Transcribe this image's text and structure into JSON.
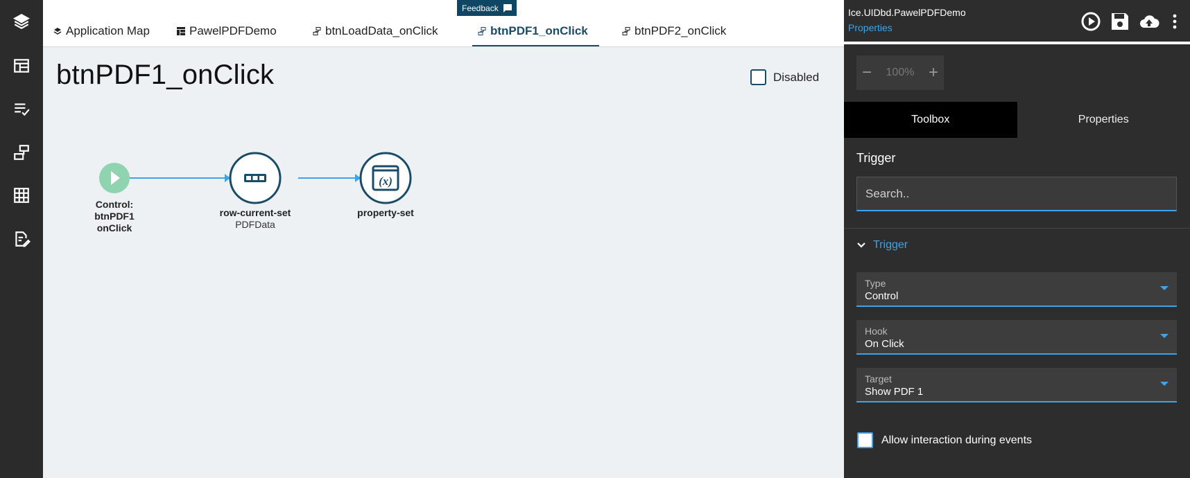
{
  "rail": {
    "items": [
      "layers-icon",
      "layout-icon",
      "checklist-icon",
      "flow-icon",
      "table-icon",
      "edit-doc-icon"
    ]
  },
  "feedback": {
    "label": "Feedback"
  },
  "tabs": [
    {
      "label": "Application Map",
      "icon": "layers-icon"
    },
    {
      "label": "PawelPDFDemo",
      "icon": "layout-icon"
    },
    {
      "label": "btnLoadData_onClick",
      "icon": "flow-icon"
    },
    {
      "label": "btnPDF1_onClick",
      "icon": "flow-icon",
      "active": true
    },
    {
      "label": "btnPDF2_onClick",
      "icon": "flow-icon"
    }
  ],
  "canvas": {
    "title": "btnPDF1_onClick",
    "disabled_label": "Disabled",
    "nodes": [
      {
        "line1": "Control:",
        "line2": "btnPDF1",
        "line3": "onClick",
        "kind": "trigger"
      },
      {
        "line1": "row-current-set",
        "sub": "PDFData",
        "kind": "action"
      },
      {
        "line1": "property-set",
        "kind": "variable"
      }
    ]
  },
  "panel": {
    "app_name": "Ice.UIDbd.PawelPDFDemo",
    "app_sub": "Properties",
    "zoom": "100%",
    "tabs": [
      "Toolbox",
      "Properties"
    ],
    "section_title": "Trigger",
    "search_placeholder": "Search..",
    "accordion_title": "Trigger",
    "fields": [
      {
        "label": "Type",
        "value": "Control"
      },
      {
        "label": "Hook",
        "value": "On Click"
      },
      {
        "label": "Target",
        "value": "Show PDF 1"
      }
    ],
    "allow_label": "Allow interaction during events"
  },
  "colors": {
    "accent": "#3ea3e8",
    "dark_teal": "#1a4c6a",
    "trigger_green": "#8fd3b0"
  }
}
